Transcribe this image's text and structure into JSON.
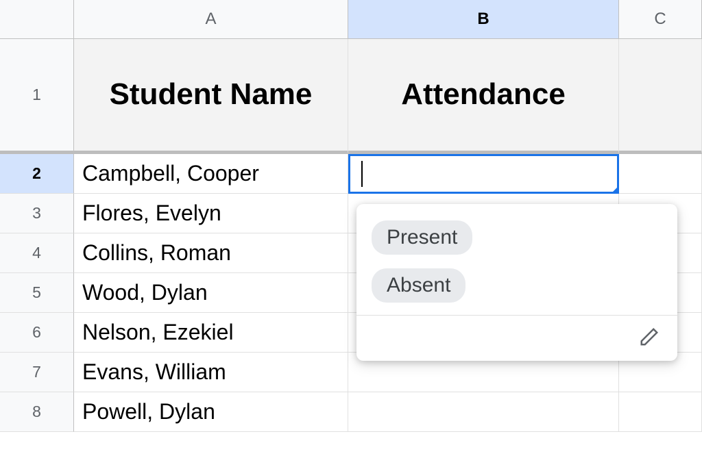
{
  "columns": {
    "A": "A",
    "B": "B",
    "C": "C"
  },
  "header_row": {
    "student_name": "Student Name",
    "attendance": "Attendance"
  },
  "row_numbers": [
    "1",
    "2",
    "3",
    "4",
    "5",
    "6",
    "7",
    "8"
  ],
  "students": [
    "Campbell, Cooper",
    "Flores, Evelyn",
    "Collins, Roman",
    "Wood, Dylan",
    "Nelson, Ezekiel",
    "Evans, William",
    "Powell, Dylan"
  ],
  "active_cell_value": "",
  "dropdown_options": {
    "present": "Present",
    "absent": "Absent"
  },
  "chart_data": {
    "type": "table",
    "columns": [
      "Student Name",
      "Attendance"
    ],
    "rows": [
      [
        "Campbell, Cooper",
        ""
      ],
      [
        "Flores, Evelyn",
        ""
      ],
      [
        "Collins, Roman",
        ""
      ],
      [
        "Wood, Dylan",
        ""
      ],
      [
        "Nelson, Ezekiel",
        ""
      ],
      [
        "Evans, William",
        ""
      ],
      [
        "Powell, Dylan",
        ""
      ]
    ],
    "validation_options": [
      "Present",
      "Absent"
    ]
  }
}
